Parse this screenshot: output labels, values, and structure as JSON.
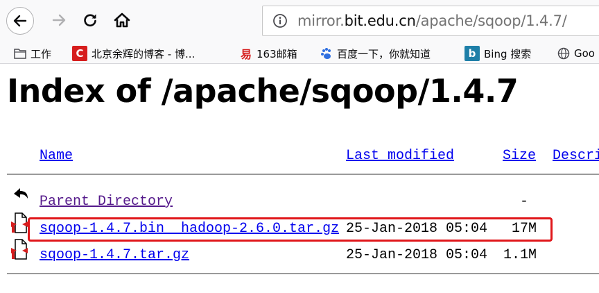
{
  "browser": {
    "url_scheme_host": "mirror.",
    "url_domain": "bit.edu.cn",
    "url_path": "/apache/sqoop/1.4.7/"
  },
  "bookmarks": [
    {
      "label": "工作",
      "icon": "folder-icon"
    },
    {
      "label": "北京余辉的博客 - 博...",
      "icon": "csdn-icon"
    },
    {
      "label": "163邮箱",
      "icon": "netease-mail-icon"
    },
    {
      "label": "百度一下，你就知道",
      "icon": "baidu-icon"
    },
    {
      "label": "Bing 搜索",
      "icon": "bing-icon"
    },
    {
      "label": "Goo",
      "icon": "globe-icon"
    }
  ],
  "page": {
    "title": "Index of /apache/sqoop/1.4.7",
    "columns": {
      "name": "Name",
      "last_modified": "Last modified",
      "size": "Size",
      "description": "Descri"
    },
    "parent": {
      "name": "Parent Directory",
      "size": "-"
    },
    "files": [
      {
        "name": "sqoop-1.4.7.bin__hadoop-2.6.0.tar.gz",
        "modified": "25-Jan-2018 05:04",
        "size": "17M",
        "highlighted": true
      },
      {
        "name": "sqoop-1.4.7.tar.gz",
        "modified": "25-Jan-2018 05:04",
        "size": "1.1M",
        "highlighted": false
      }
    ],
    "highlight_color": "#e0161a"
  }
}
